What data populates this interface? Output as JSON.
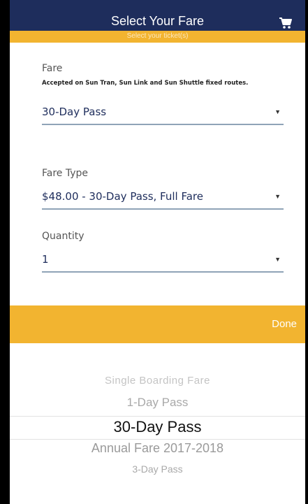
{
  "header": {
    "title": "Select Your Fare",
    "cart_icon": "cart-icon",
    "subtitle": "Select your ticket(s)"
  },
  "fare": {
    "label": "Fare",
    "note": "Accepted on Sun Tran, Sun Link and Sun Shuttle fixed routes.",
    "value": "30-Day Pass"
  },
  "fare_type": {
    "label": "Fare Type",
    "value": "$48.00 - 30-Day Pass, Full Fare"
  },
  "quantity": {
    "label": "Quantity",
    "value": "1"
  },
  "done_label": "Done",
  "picker": {
    "items": [
      "Single Boarding Fare",
      "1-Day Pass",
      "30-Day Pass",
      "Annual Fare 2017-2018",
      "3-Day Pass"
    ]
  },
  "colors": {
    "header_bg": "#1e2d5c",
    "accent": "#f2b430",
    "field_text": "#1e2d5c"
  }
}
